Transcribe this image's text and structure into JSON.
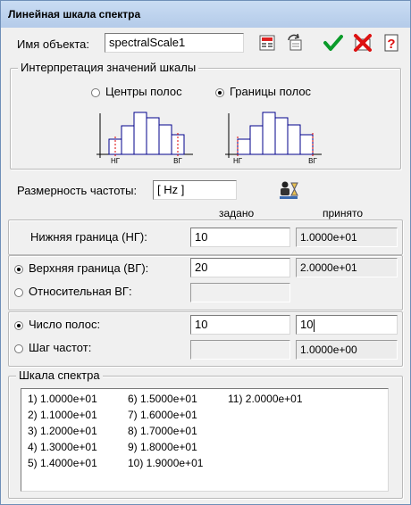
{
  "window": {
    "title": "Линейная шкала спектра"
  },
  "object": {
    "label": "Имя объекта:",
    "value": "spectralScale1"
  },
  "interpretation": {
    "title": "Интерпретация значений шкалы",
    "option_centers": "Центры полос",
    "option_bounds": "Границы полос",
    "selected": "bounds",
    "diagram_lower_label": "НГ",
    "diagram_upper_label": "ВГ"
  },
  "frequency": {
    "label": "Размерность частоты:",
    "value": "[ Hz ]"
  },
  "headers": {
    "set": "задано",
    "accepted": "принято"
  },
  "lower": {
    "label": "Нижняя граница (НГ):",
    "value": "10",
    "accepted": "1.0000e+01"
  },
  "upper": {
    "label": "Верхняя граница (ВГ):",
    "value": "20",
    "accepted": "2.0000e+01",
    "relative_label": "Относительная ВГ:",
    "selected": "upper"
  },
  "bands": {
    "count_label": "Число полос:",
    "count_value": "10",
    "count_accepted": "10",
    "step_label": "Шаг частот:",
    "step_accepted": "1.0000e+00",
    "selected": "count"
  },
  "spectrum": {
    "title": "Шкала спектра",
    "items": [
      "1)  1.0000e+01",
      "2)  1.1000e+01",
      "3)  1.2000e+01",
      "4)  1.3000e+01",
      "5)  1.4000e+01",
      "6)  1.5000e+01",
      "7)  1.6000e+01",
      "8)  1.7000e+01",
      "9)  1.8000e+01",
      "10)  1.9000e+01",
      "11)  2.0000e+01"
    ]
  },
  "toolbar": [
    "save-icon",
    "refresh-icon",
    "ok-check-icon",
    "cancel-icon",
    "help-icon"
  ]
}
